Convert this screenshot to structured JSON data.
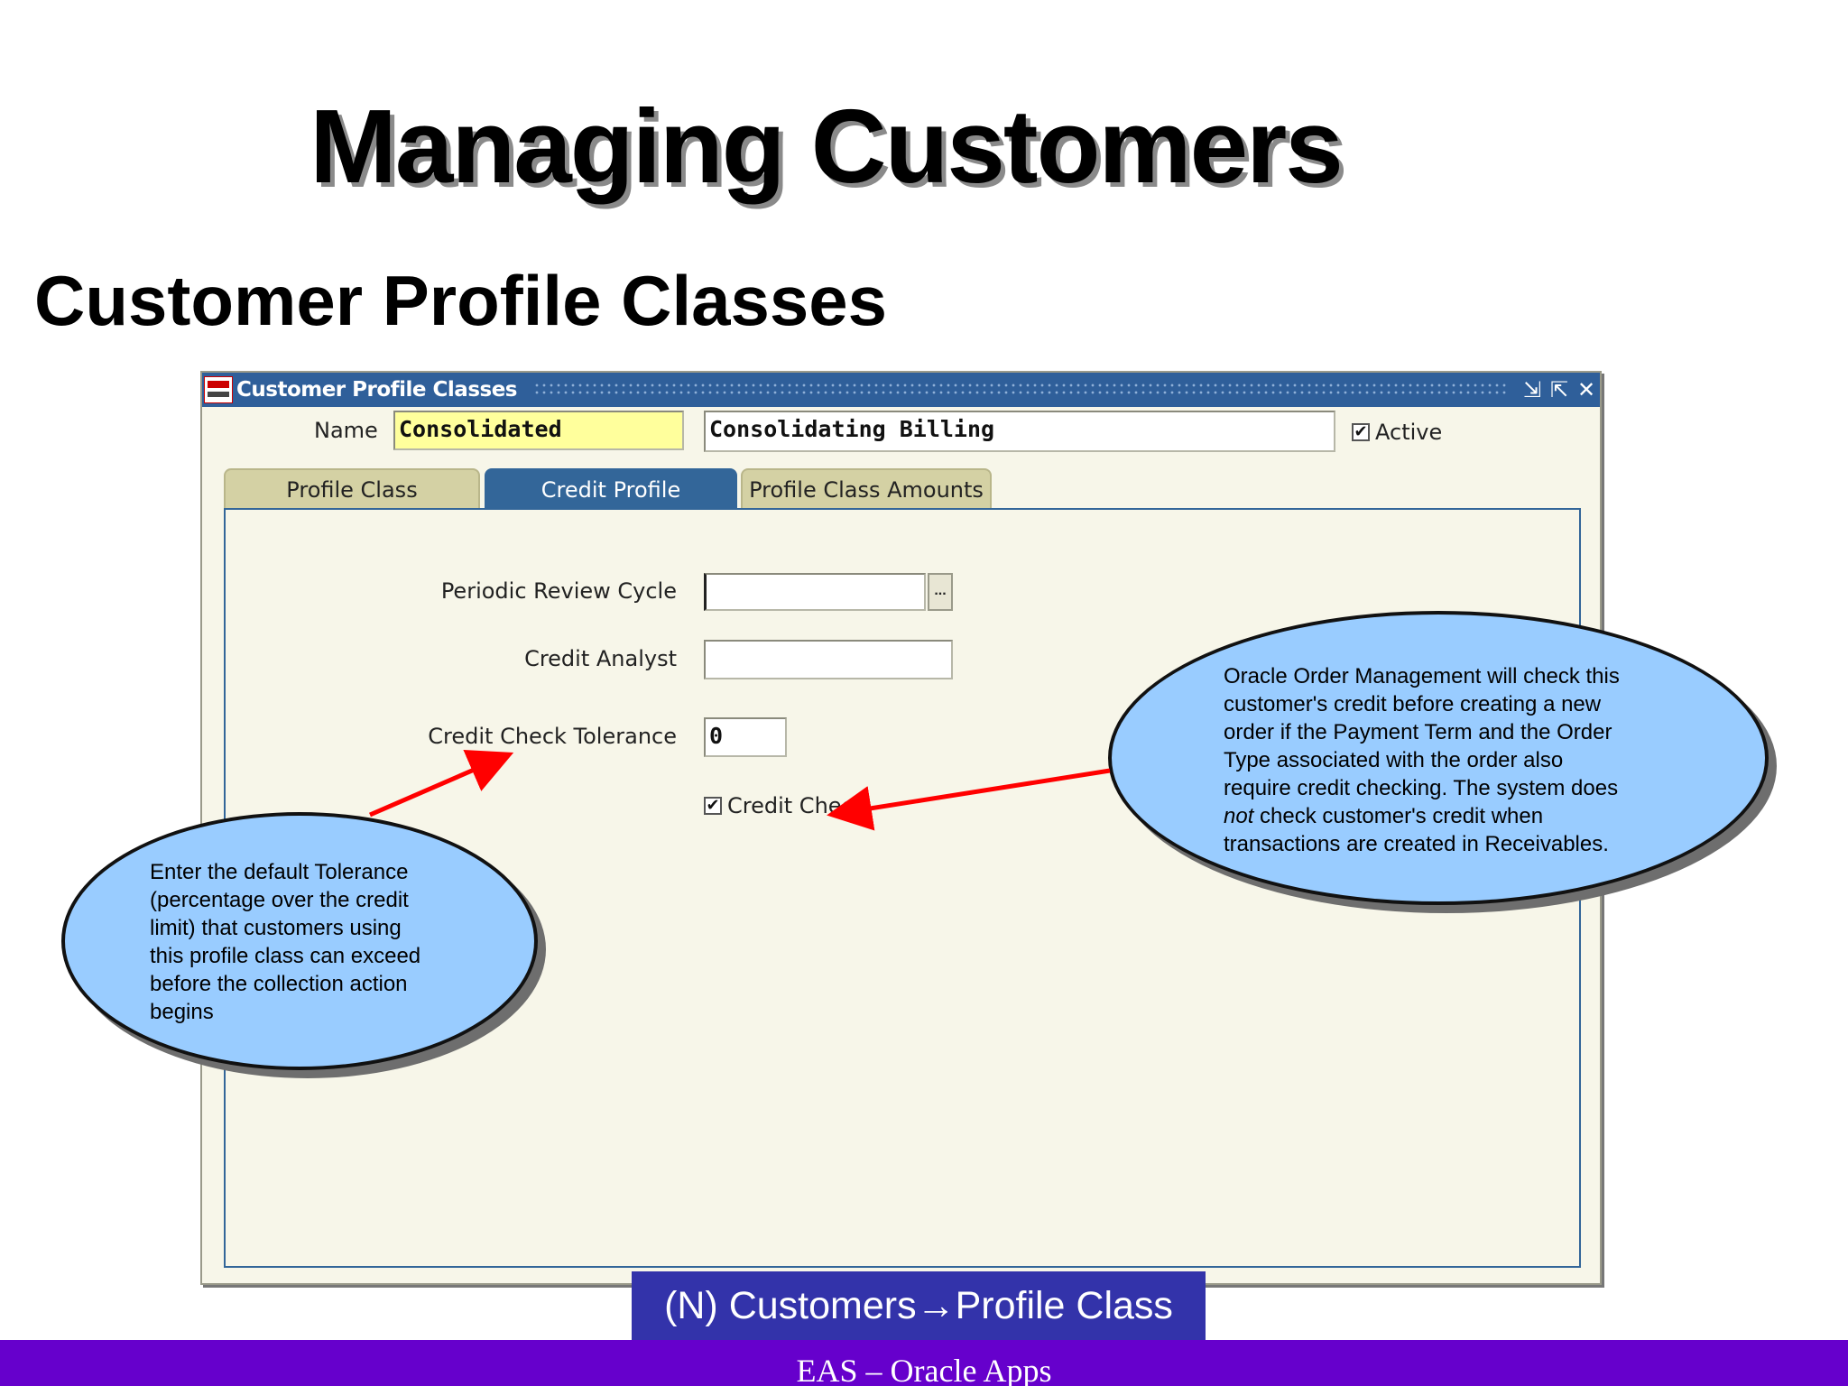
{
  "slide": {
    "title": "Managing Customers",
    "subtitle": "Customer Profile Classes"
  },
  "window": {
    "title": "Customer Profile Classes",
    "controls": [
      "minimize-icon",
      "maximize-icon",
      "close-icon"
    ],
    "control_glyphs": [
      "⇲",
      "⇱",
      "✕"
    ]
  },
  "header": {
    "name_label": "Name",
    "name_value": "Consolidated",
    "description_value": "Consolidating Billing",
    "active_label": "Active",
    "active_checked": true
  },
  "tabs": [
    {
      "label": "Profile Class",
      "active": false
    },
    {
      "label": "Credit Profile",
      "active": true
    },
    {
      "label": "Profile Class Amounts",
      "active": false
    }
  ],
  "credit_profile": {
    "periodic_review_label": "Periodic Review Cycle",
    "periodic_review_value": "",
    "lov_glyph": "...",
    "credit_analyst_label": "Credit Analyst",
    "credit_analyst_value": "",
    "tolerance_label": "Credit Check Tolerance",
    "tolerance_value": "0",
    "credit_check_label": "Credit Check",
    "credit_check_checked": true
  },
  "callouts": {
    "left": [
      "Enter the default Tolerance",
      "(percentage over the credit",
      "limit) that customers using",
      "this profile class can exceed",
      "before the collection action",
      "begins"
    ],
    "right": {
      "line1": "Oracle Order Management will check this",
      "line2": "customer's credit before creating a new",
      "line3": "order if the Payment Term and the Order",
      "line4": "Type associated with the order also",
      "line5": "require credit checking. The system does",
      "line6_italic": "not",
      "line6_rest": " check customer's credit when",
      "line7": "transactions are created in Receivables."
    }
  },
  "navigation": "(N) Customers→Profile Class",
  "footer": "EAS – Oracle Apps",
  "colors": {
    "titlebar": "#2f5f9a",
    "active_tab": "#336699",
    "inactive_tab": "#d4d1a4",
    "form_bg": "#f7f6e9",
    "required_field": "#ffff9c",
    "callout_fill": "#99ccff",
    "arrow": "#ff0000",
    "nav_box": "#3333aa",
    "footer_bar": "#6600cc"
  }
}
